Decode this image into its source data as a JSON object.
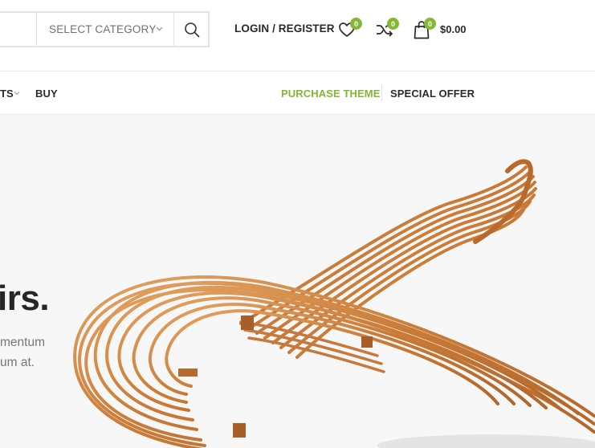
{
  "header": {
    "search": {
      "category_label": "SELECT CATEGORY",
      "search_icon": "search-icon"
    },
    "login_label": "LOGIN / REGISTER",
    "wishlist": {
      "icon": "heart-icon",
      "count": "0"
    },
    "compare": {
      "icon": "shuffle-icon",
      "count": "0"
    },
    "cart": {
      "icon": "shopping-bag-icon",
      "count": "0",
      "total": "$0.00"
    }
  },
  "nav": {
    "left_items": [
      {
        "label": "TS",
        "has_dropdown": true
      },
      {
        "label": "BUY",
        "has_dropdown": false
      }
    ],
    "right_items": [
      {
        "label": "PURCHASE THEME",
        "highlighted": true
      },
      {
        "label": "SPECIAL OFFER",
        "highlighted": false
      }
    ]
  },
  "hero": {
    "heading": "irs.",
    "text_line_1": "mentum",
    "text_line_2": "um at.",
    "image": "wooden-lounge-chair"
  },
  "colors": {
    "accent": "#83b735",
    "text_dark": "#2a2a2a",
    "hero_bg": "#f7f7f7",
    "wood": "#d98f4a"
  }
}
